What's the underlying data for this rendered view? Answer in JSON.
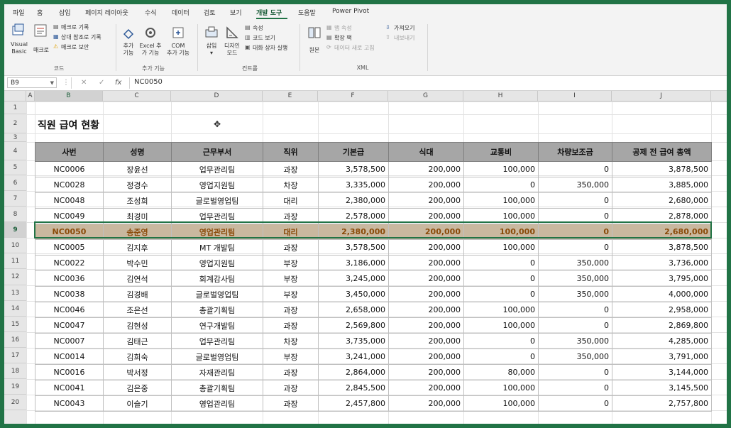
{
  "ribbon_tabs": [
    "파일",
    "홈",
    "삽입",
    "페이지 레이아웃",
    "수식",
    "데이터",
    "검토",
    "보기",
    "개발 도구",
    "도움말",
    "Power Pivot"
  ],
  "active_tab": "개발 도구",
  "ribbon": {
    "code": {
      "visual_basic_1": "Visual",
      "visual_basic_2": "Basic",
      "macro": "매크로",
      "record_macro": "매크로 기록",
      "relative_ref": "상대 참조로 기록",
      "macro_security": "매크로 보안",
      "group_label": "코드"
    },
    "addins": {
      "addins_1": "추가",
      "addins_2": "기능",
      "excel_addins_1": "Excel 추",
      "excel_addins_2": "가 기능",
      "com_addins_1": "COM",
      "com_addins_2": "추가 기능",
      "group_label": "추가 기능"
    },
    "controls": {
      "insert": "삽입",
      "design_mode_1": "디자인",
      "design_mode_2": "모드",
      "properties": "속성",
      "view_code": "코드 보기",
      "run_dialog": "대화 상자 실행",
      "group_label": "컨트롤"
    },
    "xml": {
      "source": "원본",
      "map_properties": "맵 속성",
      "expansion_packs": "확장 팩",
      "refresh_data": "데이터 새로 고침",
      "import": "가져오기",
      "export": "내보내기",
      "group_label": "XML"
    }
  },
  "formula_bar": {
    "name_box": "B9",
    "cancel_icon": "✕",
    "enter_icon": "✓",
    "fx": "fx",
    "value": "NC0050"
  },
  "column_headers": [
    "A",
    "B",
    "C",
    "D",
    "E",
    "F",
    "G",
    "H",
    "I",
    "J"
  ],
  "row_numbers": [
    "1",
    "2",
    "3",
    "4",
    "5",
    "6",
    "7",
    "8",
    "9",
    "10",
    "11",
    "12",
    "13",
    "14",
    "15",
    "16",
    "17",
    "18",
    "19",
    "20"
  ],
  "sheet_title": "직원 급여 현황",
  "table": {
    "headers": [
      "사번",
      "성명",
      "근무부서",
      "직위",
      "기본급",
      "식대",
      "교통비",
      "차량보조금",
      "공제 전 급여 총액"
    ],
    "rows": [
      [
        "NC0006",
        "장윤선",
        "업무관리팀",
        "과장",
        "3,578,500",
        "200,000",
        "100,000",
        "0",
        "3,878,500"
      ],
      [
        "NC0028",
        "정경수",
        "영업지원팀",
        "차장",
        "3,335,000",
        "200,000",
        "0",
        "350,000",
        "3,885,000"
      ],
      [
        "NC0048",
        "조성희",
        "글로벌영업팀",
        "대리",
        "2,380,000",
        "200,000",
        "100,000",
        "0",
        "2,680,000"
      ],
      [
        "NC0049",
        "최경미",
        "업무관리팀",
        "과장",
        "2,578,000",
        "200,000",
        "100,000",
        "0",
        "2,878,000"
      ],
      [
        "NC0050",
        "송준영",
        "영업관리팀",
        "대리",
        "2,380,000",
        "200,000",
        "100,000",
        "0",
        "2,680,000"
      ],
      [
        "NC0005",
        "김지후",
        "MT 개발팀",
        "과장",
        "3,578,500",
        "200,000",
        "100,000",
        "0",
        "3,878,500"
      ],
      [
        "NC0022",
        "박수민",
        "영업지원팀",
        "부장",
        "3,186,000",
        "200,000",
        "0",
        "350,000",
        "3,736,000"
      ],
      [
        "NC0036",
        "김연석",
        "회계감사팀",
        "부장",
        "3,245,000",
        "200,000",
        "0",
        "350,000",
        "3,795,000"
      ],
      [
        "NC0038",
        "김경배",
        "글로벌영업팀",
        "부장",
        "3,450,000",
        "200,000",
        "0",
        "350,000",
        "4,000,000"
      ],
      [
        "NC0046",
        "조은선",
        "총괄기획팀",
        "과장",
        "2,658,000",
        "200,000",
        "100,000",
        "0",
        "2,958,000"
      ],
      [
        "NC0047",
        "김현성",
        "연구개발팀",
        "과장",
        "2,569,800",
        "200,000",
        "100,000",
        "0",
        "2,869,800"
      ],
      [
        "NC0007",
        "김태근",
        "업무관리팀",
        "차장",
        "3,735,000",
        "200,000",
        "0",
        "350,000",
        "4,285,000"
      ],
      [
        "NC0014",
        "김희숙",
        "글로벌영업팀",
        "부장",
        "3,241,000",
        "200,000",
        "0",
        "350,000",
        "3,791,000"
      ],
      [
        "NC0016",
        "박서정",
        "자재관리팀",
        "과장",
        "2,864,000",
        "200,000",
        "80,000",
        "0",
        "3,144,000"
      ],
      [
        "NC0041",
        "김은중",
        "총괄기획팀",
        "과장",
        "2,845,500",
        "200,000",
        "100,000",
        "0",
        "3,145,500"
      ],
      [
        "NC0043",
        "이슬기",
        "영업관리팀",
        "과장",
        "2,457,800",
        "200,000",
        "100,000",
        "0",
        "2,757,800"
      ]
    ],
    "highlighted_row_index": 4
  },
  "colors": {
    "frame_green": "#217346",
    "header_fill": "#a6a6a6",
    "highlight_fill": "#c9b89f",
    "highlight_text": "#8a4a08"
  }
}
